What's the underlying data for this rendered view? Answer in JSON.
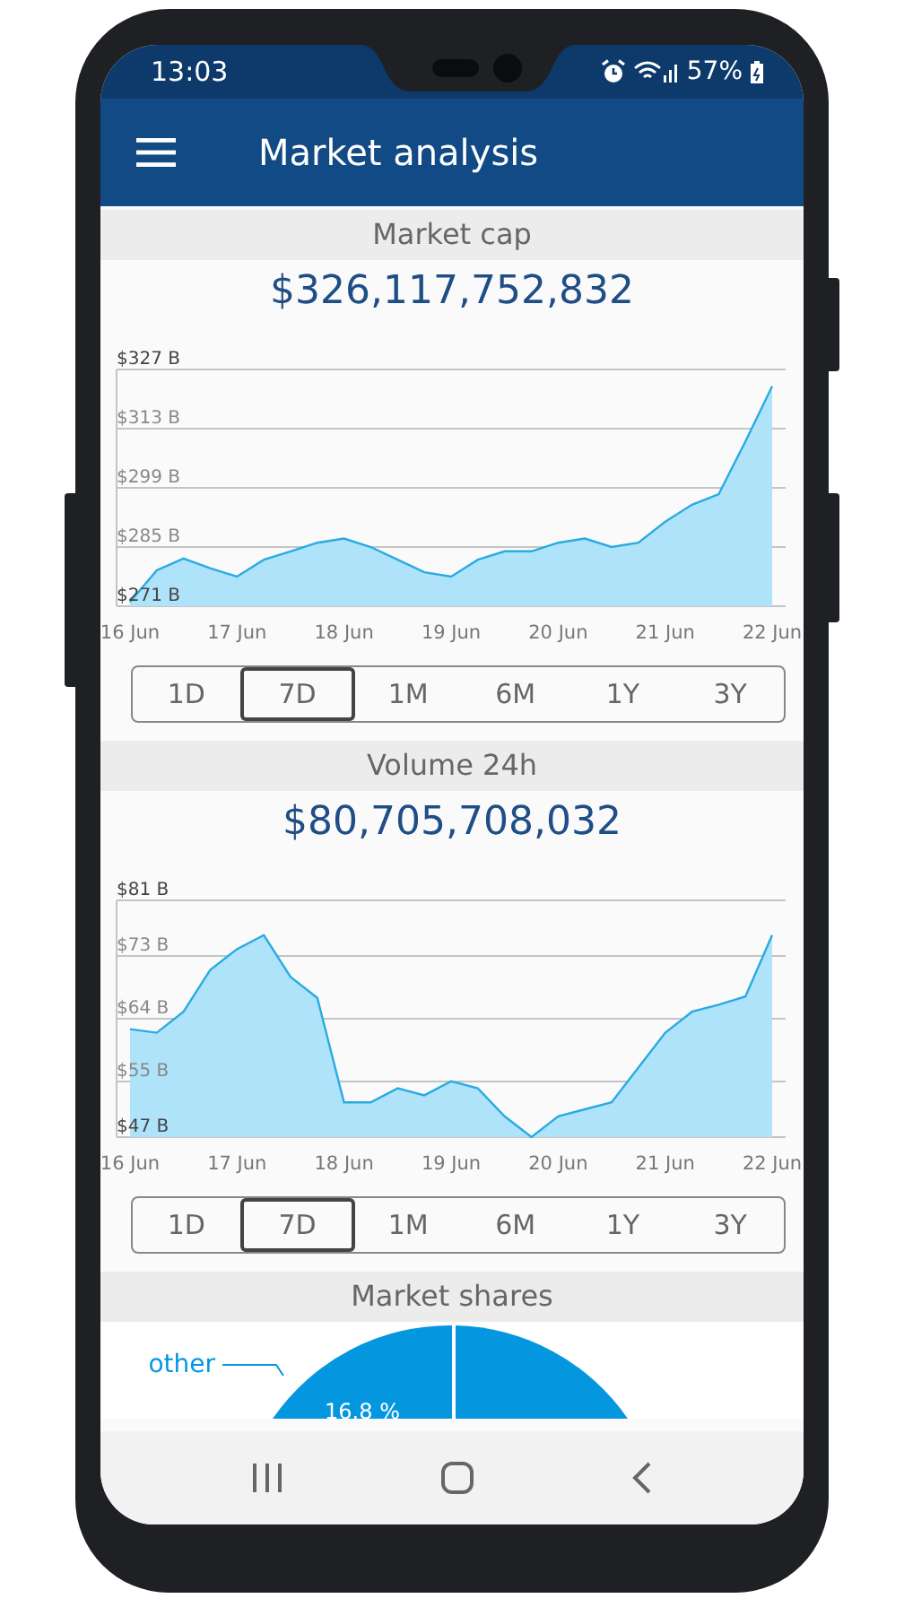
{
  "status_bar": {
    "time": "13:03",
    "battery": "57%"
  },
  "app_bar": {
    "title": "Market analysis"
  },
  "sections": [
    {
      "title": "Market cap",
      "value": "$326,117,752,832",
      "chart_data": {
        "type": "area",
        "categories": [
          "16 Jun",
          null,
          null,
          null,
          "17 Jun",
          null,
          null,
          null,
          "18 Jun",
          null,
          null,
          null,
          "19 Jun",
          null,
          null,
          null,
          "20 Jun",
          null,
          null,
          null,
          "21 Jun",
          null,
          null,
          null,
          "22 Jun"
        ],
        "series": [
          {
            "color": "#aee3fa",
            "values": [
              272,
              279.5,
              282.3,
              280,
              278,
              282,
              284,
              286,
              287,
              285,
              282,
              279,
              278,
              282,
              284,
              284,
              286,
              287,
              285,
              286,
              291,
              295,
              297.5,
              310,
              323
            ]
          }
        ],
        "ylim": [
          271,
          327
        ],
        "grid": true,
        "yticks": [
          {
            "value": 271,
            "label": "$271 B"
          },
          {
            "value": 285,
            "label": "$285 B"
          },
          {
            "value": 299,
            "label": "$299 B"
          },
          {
            "value": 313,
            "label": "$313 B"
          },
          {
            "value": 327,
            "label": "$327 B"
          }
        ]
      },
      "ranges": [
        {
          "label": "1D",
          "selected": false
        },
        {
          "label": "7D",
          "selected": true
        },
        {
          "label": "1M",
          "selected": false
        },
        {
          "label": "6M",
          "selected": false
        },
        {
          "label": "1Y",
          "selected": false
        },
        {
          "label": "3Y",
          "selected": false
        }
      ]
    },
    {
      "title": "Volume 24h",
      "value": "$80,705,708,032",
      "chart_data": {
        "type": "area",
        "categories": [
          "16 Jun",
          null,
          null,
          null,
          "17 Jun",
          null,
          null,
          null,
          "18 Jun",
          null,
          null,
          null,
          "19 Jun",
          null,
          null,
          null,
          "20 Jun",
          null,
          null,
          null,
          "21 Jun",
          null,
          null,
          null,
          "22 Jun"
        ],
        "series": [
          {
            "color": "#aee3fa",
            "values": [
              62.5,
              62,
              65,
              71,
              74,
              76,
              70,
              67,
              52,
              52,
              54,
              53,
              55,
              54,
              50,
              47,
              50,
              51,
              52,
              57,
              62,
              65,
              66,
              67.2,
              76
            ]
          }
        ],
        "ylim": [
          47,
          81
        ],
        "grid": true,
        "yticks": [
          {
            "value": 47,
            "label": "$47 B"
          },
          {
            "value": 55,
            "label": "$55 B"
          },
          {
            "value": 64,
            "label": "$64 B"
          },
          {
            "value": 73,
            "label": "$73 B"
          },
          {
            "value": 81,
            "label": "$81 B"
          }
        ]
      },
      "ranges": [
        {
          "label": "1D",
          "selected": false
        },
        {
          "label": "7D",
          "selected": true
        },
        {
          "label": "1M",
          "selected": false
        },
        {
          "label": "6M",
          "selected": false
        },
        {
          "label": "1Y",
          "selected": false
        },
        {
          "label": "3Y",
          "selected": false
        }
      ]
    }
  ],
  "market_shares": {
    "title": "Market shares",
    "slices": [
      {
        "label": "other",
        "percent": "16.8 %",
        "color": "#0497e0"
      }
    ]
  }
}
